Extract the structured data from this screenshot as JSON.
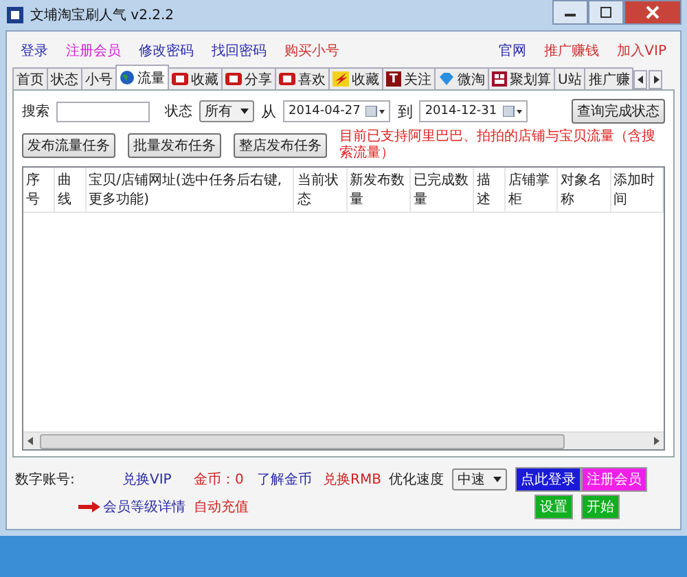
{
  "window": {
    "title": "文埔淘宝刷人气 v2.2.2"
  },
  "menu_left": [
    {
      "label": "登录",
      "color": "#2b2bb0"
    },
    {
      "label": "注册会员",
      "color": "#d020d0"
    },
    {
      "label": "修改密码",
      "color": "#2b2bb0"
    },
    {
      "label": "找回密码",
      "color": "#2b2bb0"
    },
    {
      "label": "购买小号",
      "color": "#d03030"
    }
  ],
  "menu_right": [
    {
      "label": "官网",
      "color": "#2b2bb0"
    },
    {
      "label": "推广赚钱",
      "color": "#d03030"
    },
    {
      "label": "加入VIP",
      "color": "#d03030"
    }
  ],
  "tabs": [
    {
      "label": "首页",
      "selected": false
    },
    {
      "label": "状态",
      "selected": false
    },
    {
      "label": "小号",
      "selected": false
    },
    {
      "label": "流量",
      "selected": true,
      "kind": "globe"
    },
    {
      "label": "收藏",
      "selected": false,
      "kind": "badge"
    },
    {
      "label": "分享",
      "selected": false,
      "kind": "badge"
    },
    {
      "label": "喜欢",
      "selected": false,
      "kind": "badge"
    },
    {
      "label": "收藏",
      "selected": false,
      "kind": "flash"
    },
    {
      "label": "关注",
      "selected": false,
      "kind": "letter",
      "icon_text": "T"
    },
    {
      "label": "微淘",
      "selected": false,
      "kind": "diamond"
    },
    {
      "label": "聚划算",
      "selected": false,
      "kind": "grid"
    },
    {
      "label": "U站",
      "selected": false
    },
    {
      "label": "推广赚",
      "selected": false
    }
  ],
  "filter": {
    "search_label": "搜索",
    "status_label": "状态",
    "status_value": "所有",
    "from_label": "从",
    "from_date": "2014-04-27",
    "to_label": "到",
    "to_date": "2014-12-31",
    "query_button": "查询完成状态"
  },
  "actions": [
    "发布流量任务",
    "批量发布任务",
    "整店发布任务"
  ],
  "notice": "目前已支持阿里巴巴、拍拍的店铺与宝贝流量（含搜索流量）",
  "table": {
    "columns": [
      "序号",
      "曲线",
      "宝贝/店铺网址(选中任务后右键,更多功能)",
      "当前状态",
      "新发布数量",
      "已完成数量",
      "描述",
      "店铺掌柜",
      "对象名称",
      "添加时间"
    ]
  },
  "footer": {
    "account_label": "数字账号:",
    "exchange_vip": "兑换VIP",
    "coins": "金币：0",
    "learn_coins": "了解金币",
    "exchange_rmb": "兑换RMB",
    "speed_label": "优化速度",
    "speed_value": "中速",
    "login_button": "点此登录",
    "register_button": "注册会员",
    "member_link": "会员等级详情",
    "auto_recharge": "自动充值",
    "settings_button": "设置",
    "start_button": "开始"
  }
}
